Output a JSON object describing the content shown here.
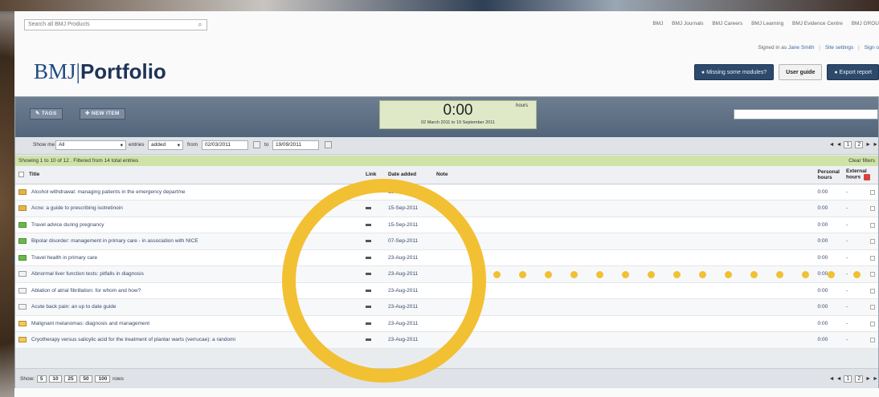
{
  "search": {
    "placeholder": "Search all BMJ Products",
    "icon": "search-icon"
  },
  "top_links": [
    "BMJ",
    "BMJ Journals",
    "BMJ Careers",
    "BMJ Learning",
    "BMJ Evidence Centre",
    "BMJ GROU"
  ],
  "signed_in": {
    "prefix": "Signed in as",
    "user": "Jane Smith",
    "settings": "Site settings",
    "signout": "Sign o"
  },
  "logo": {
    "bmj": "BMJ",
    "product": "Portfolio"
  },
  "header_buttons": {
    "missing": "● Missing some modules?",
    "guide": "User guide",
    "export": "● Export report"
  },
  "toolbar": {
    "tags": "✎ TAGS",
    "new_item": "✚ NEW ITEM",
    "timer": {
      "time": "0:00",
      "unit": "hours",
      "range": "02 March 2011 to 19 September 2011"
    }
  },
  "filters": {
    "show_label": "Show me",
    "show_value": "All",
    "entries_label": "entries",
    "entries_value": "added",
    "from_label": "from",
    "from_date": "02/03/2011",
    "to_label": "to",
    "to_date": "19/09/2011",
    "pager": {
      "first": "◄",
      "prev": "◄",
      "pages": [
        "1",
        "2"
      ],
      "next": "►",
      "last": "►"
    }
  },
  "status": {
    "text": "Showing 1 to 10 of 12 . Filtered from 14 total entries",
    "clear": "Clear filters"
  },
  "table": {
    "headers": {
      "title": "Title",
      "link": "Link",
      "date": "Date added",
      "note": "Note",
      "personal": "Personal hours",
      "external": "External hours"
    },
    "rows": [
      {
        "icon": "folder",
        "title": "Alcohol withdrawal: managing patients in the emergency departme",
        "date": "15-Sep-2011",
        "personal": "0:00",
        "external": "-"
      },
      {
        "icon": "folder",
        "title": "Acne: a guide to prescribing isotretinoin",
        "date": "15-Sep-2011",
        "personal": "0:00",
        "external": "-"
      },
      {
        "icon": "green",
        "title": "Travel advice during pregnancy",
        "date": "15-Sep-2011",
        "personal": "0:00",
        "external": "-"
      },
      {
        "icon": "green",
        "title": "Bipolar disorder: management in primary care - in association with NICE",
        "date": "07-Sep-2011",
        "personal": "0:00",
        "external": "-"
      },
      {
        "icon": "green",
        "title": "Travel health in primary care",
        "date": "23-Aug-2011",
        "personal": "0:00",
        "external": "-"
      },
      {
        "icon": "doc",
        "title": "Abnormal liver function tests: pitfalls in diagnosis",
        "date": "23-Aug-2011",
        "personal": "0:00",
        "external": "-"
      },
      {
        "icon": "doc",
        "title": "Ablation of atrial fibrillation: for whom and how?",
        "date": "23-Aug-2011",
        "personal": "0:00",
        "external": "-"
      },
      {
        "icon": "doc",
        "title": "Acute back pain: an up to date guide",
        "date": "23-Aug-2011",
        "personal": "0:00",
        "external": "-"
      },
      {
        "icon": "check",
        "title": "Malignant melanomas: diagnosis and management",
        "date": "23-Aug-2011",
        "personal": "0:00",
        "external": "-"
      },
      {
        "icon": "check",
        "title": "Cryotherapy versus salicylic acid for the treatment of plantar warts (verrucae): a randomi",
        "date": "23-Aug-2011",
        "personal": "0:00",
        "external": "-"
      }
    ]
  },
  "footer": {
    "show_label": "Show:",
    "options": [
      "5",
      "10",
      "25",
      "50",
      "100"
    ],
    "rows_label": "rows"
  },
  "colors": {
    "accent": "#f2c033",
    "brand": "#1f4a82",
    "toolbar": "#5b6d82",
    "status": "#cfe3a8"
  }
}
